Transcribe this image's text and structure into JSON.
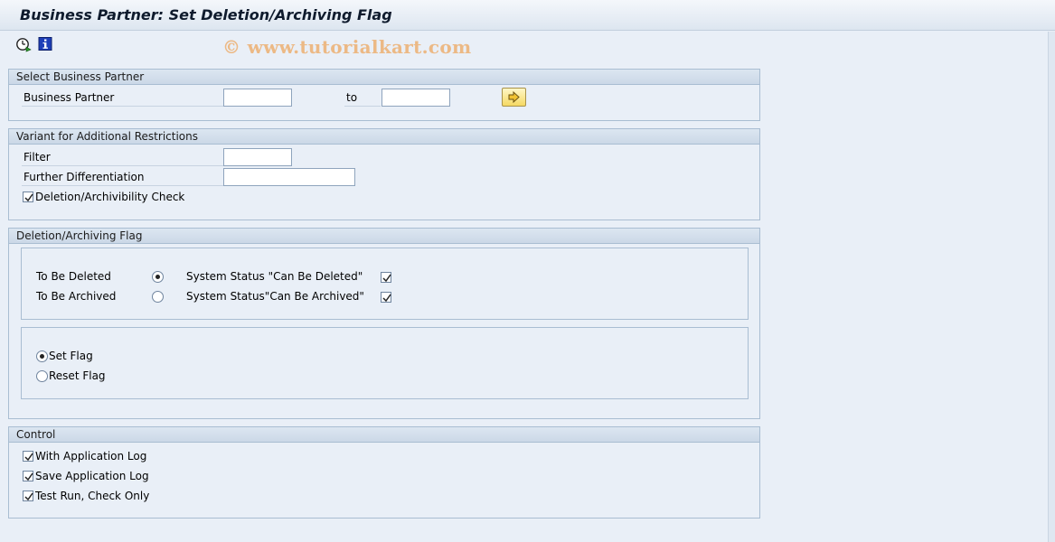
{
  "window": {
    "title": "Business Partner: Set Deletion/Archiving Flag"
  },
  "toolbar": {
    "icons": [
      "execute-clock-icon",
      "information-icon"
    ],
    "watermark": "© www.tutorialkart.com"
  },
  "select_bp": {
    "header": "Select Business Partner",
    "bp_label": "Business Partner",
    "bp_from": "",
    "to_label": "to",
    "bp_to": "",
    "multi_select_icon": "arrow-right-icon"
  },
  "variant": {
    "header": "Variant for Additional Restrictions",
    "filter_label": "Filter",
    "filter_value": "",
    "further_label": "Further Differentiation",
    "further_value": "",
    "check_label": "Deletion/Archivibility Check",
    "check_checked": true
  },
  "flag": {
    "header": "Deletion/Archiving Flag",
    "to_be_deleted_label": "To Be Deleted",
    "to_be_deleted_selected": true,
    "status_deleted_label": "System Status \"Can Be Deleted\"",
    "status_deleted_checked": true,
    "to_be_archived_label": "To Be Archived",
    "to_be_archived_selected": false,
    "status_archived_label": "System Status\"Can Be Archived\"",
    "status_archived_checked": true,
    "set_flag_label": "Set Flag",
    "set_flag_selected": true,
    "reset_flag_label": "Reset Flag",
    "reset_flag_selected": false
  },
  "control": {
    "header": "Control",
    "with_log_label": "With Application Log",
    "with_log_checked": true,
    "save_log_label": "Save Application Log",
    "save_log_checked": true,
    "test_run_label": "Test Run, Check Only",
    "test_run_checked": true
  }
}
